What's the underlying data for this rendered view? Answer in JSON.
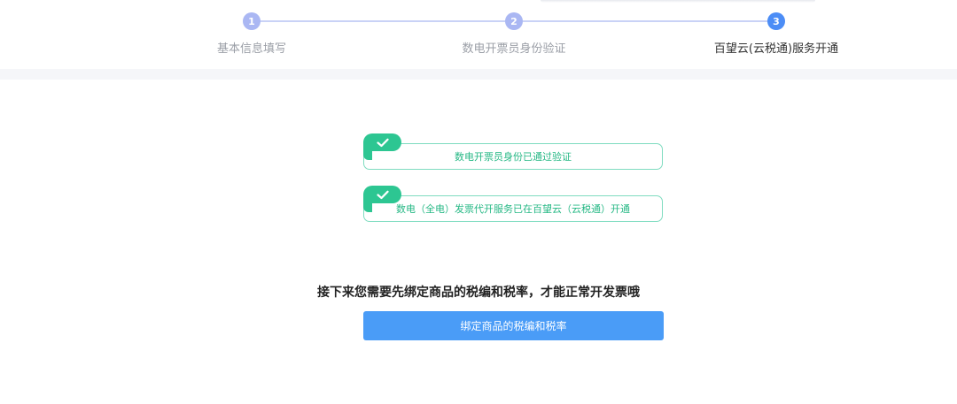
{
  "steps": [
    {
      "number": "1",
      "label": "基本信息填写",
      "status": "done"
    },
    {
      "number": "2",
      "label": "数电开票员身份验证",
      "status": "done"
    },
    {
      "number": "3",
      "label": "百望云(云税通)服务开通",
      "status": "active"
    }
  ],
  "results": [
    {
      "text": "数电开票员身份已通过验证",
      "icon": "check-icon"
    },
    {
      "text": "数电（全电）发票代开服务已在百望云（云税通）开通",
      "icon": "check-icon"
    }
  ],
  "hint_text": "接下来您需要先绑定商品的税编和税率，才能正常开发票哦",
  "bind_button_label": "绑定商品的税编和税率",
  "colors": {
    "step_done": "#aab7f3",
    "step_active": "#4c8df6",
    "success_green": "#2dc692",
    "button_blue": "#4a9cf7"
  }
}
